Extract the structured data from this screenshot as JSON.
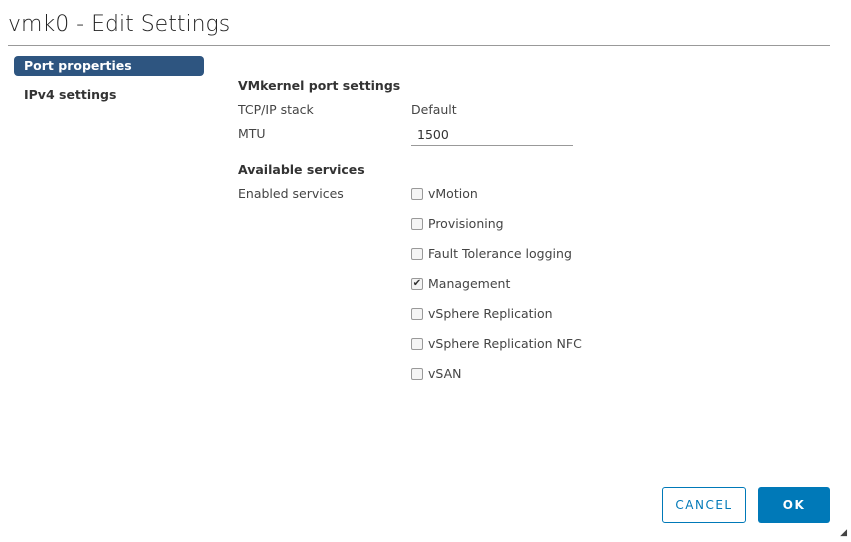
{
  "title": "vmk0 - Edit Settings",
  "nav": [
    {
      "label": "Port properties",
      "active": true
    },
    {
      "label": "IPv4 settings",
      "active": false
    }
  ],
  "port_settings": {
    "heading": "VMkernel port settings",
    "tcpip_label": "TCP/IP stack",
    "tcpip_value": "Default",
    "mtu_label": "MTU",
    "mtu_value": "1500"
  },
  "services": {
    "heading": "Available services",
    "enabled_label": "Enabled services",
    "items": [
      {
        "label": "vMotion",
        "checked": false
      },
      {
        "label": "Provisioning",
        "checked": false
      },
      {
        "label": "Fault Tolerance logging",
        "checked": false
      },
      {
        "label": "Management",
        "checked": true
      },
      {
        "label": "vSphere Replication",
        "checked": false
      },
      {
        "label": "vSphere Replication NFC",
        "checked": false
      },
      {
        "label": "vSAN",
        "checked": false
      }
    ]
  },
  "buttons": {
    "cancel": "CANCEL",
    "ok": "OK"
  },
  "colors": {
    "accent": "#0079b8",
    "nav_active": "#2e5580"
  }
}
